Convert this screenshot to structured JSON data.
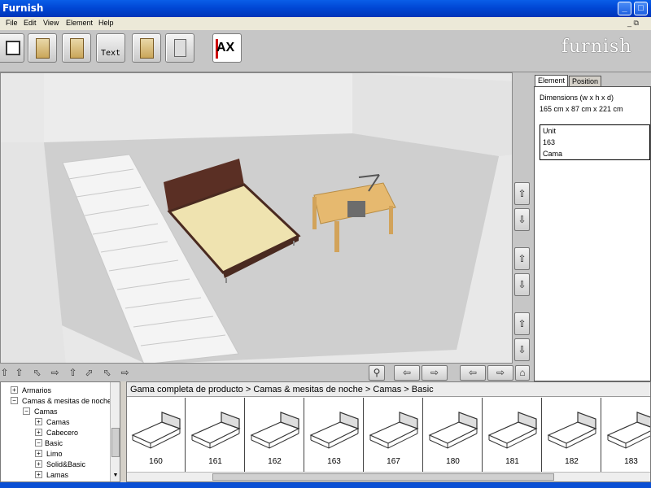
{
  "window": {
    "title": "Furnish"
  },
  "menu": {
    "items": [
      "File",
      "Edit",
      "View",
      "Element",
      "Help"
    ],
    "mdi_controls": "_ ⧉"
  },
  "toolbar": {
    "text_tool_label": "Text",
    "ax_label": "AX",
    "logo": "furnish"
  },
  "properties": {
    "tabs": [
      "Element",
      "Position"
    ],
    "dimensions_label": "Dimensions (w x h x d)",
    "dimensions_value": "165 cm x 87 cm x 221 cm",
    "info_lines": [
      "Unit",
      "163",
      "Cama"
    ]
  },
  "tree": {
    "items": [
      {
        "label": "Armarios",
        "expander": "+"
      },
      {
        "label": "Camas & mesitas de noche",
        "expander": "−"
      },
      {
        "label": "Camas",
        "expander": "−"
      },
      {
        "label": "Camas",
        "expander": "+"
      },
      {
        "label": "Cabecero",
        "expander": "+"
      },
      {
        "label": "Basic",
        "expander": "−"
      },
      {
        "label": "Limo",
        "expander": "+"
      },
      {
        "label": "Solid&Basic",
        "expander": "+"
      },
      {
        "label": "Lamas",
        "expander": "+"
      }
    ]
  },
  "catalog": {
    "breadcrumb": "Gama completa de producto > Camas & mesitas de noche > Camas > Basic",
    "products": [
      "160",
      "161",
      "162",
      "163",
      "167",
      "180",
      "181",
      "182",
      "183"
    ]
  },
  "icons": {
    "move_up": "up-arrow-icon",
    "move_down": "down-arrow-icon",
    "search": "magnifier-icon",
    "home": "home-icon"
  }
}
